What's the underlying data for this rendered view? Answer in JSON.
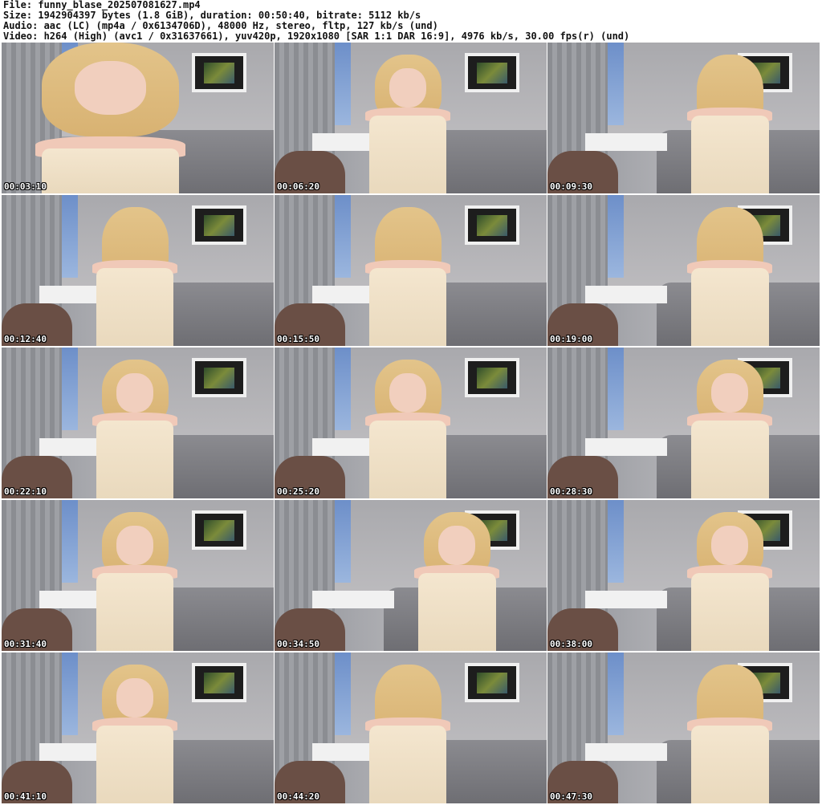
{
  "header": {
    "file_line": "File: funny_blase_202507081627.mp4",
    "size_line": "Size: 1942904397 bytes (1.8 GiB), duration: 00:50:40, bitrate: 5112 kb/s",
    "audio_line": "Audio: aac (LC) (mp4a / 0x6134706D), 48000 Hz, stereo, fltp, 127 kb/s (und)",
    "video_line": "Video: h264 (High) (avc1 / 0x31637661), yuv420p, 1920x1080 [SAR 1:1 DAR 16:9], 4976 kb/s, 30.00 fps(r) (und)"
  },
  "thumbnails": [
    {
      "timestamp": "00:03:10"
    },
    {
      "timestamp": "00:06:20"
    },
    {
      "timestamp": "00:09:30"
    },
    {
      "timestamp": "00:12:40"
    },
    {
      "timestamp": "00:15:50"
    },
    {
      "timestamp": "00:19:00"
    },
    {
      "timestamp": "00:22:10"
    },
    {
      "timestamp": "00:25:20"
    },
    {
      "timestamp": "00:28:30"
    },
    {
      "timestamp": "00:31:40"
    },
    {
      "timestamp": "00:34:50"
    },
    {
      "timestamp": "00:38:00"
    },
    {
      "timestamp": "00:41:10"
    },
    {
      "timestamp": "00:44:20"
    },
    {
      "timestamp": "00:47:30"
    }
  ]
}
